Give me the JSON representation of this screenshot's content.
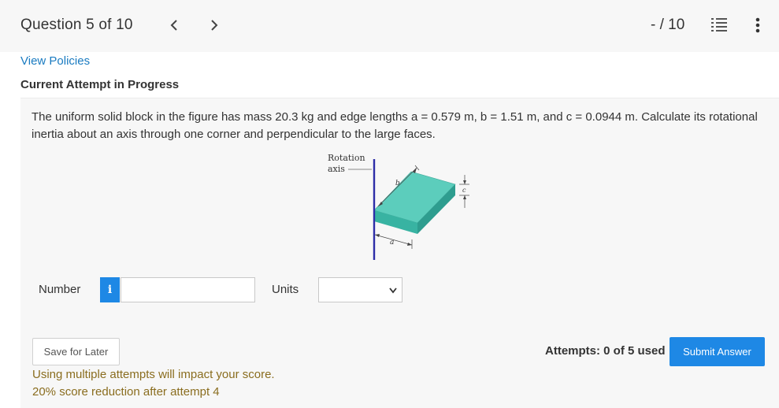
{
  "header": {
    "question_title": "Question 5 of 10",
    "score": "- / 10",
    "icons": [
      "chevron-left-icon",
      "chevron-right-icon",
      "list-icon",
      "more-vertical-icon"
    ]
  },
  "links": {
    "view_policies": "View Policies"
  },
  "attempt_heading": "Current Attempt in Progress",
  "problem": {
    "text": "The uniform solid block in the figure has mass 20.3 kg and edge lengths a = 0.579 m, b = 1.51 m, and c = 0.0944 m. Calculate its rotational inertia about an axis through one corner and perpendicular to the large faces.",
    "figure": {
      "axis_label_line1": "Rotation",
      "axis_label_line2": "axis",
      "label_a": "a",
      "label_b": "b",
      "label_c": "c",
      "block_color": "#5cc8b8",
      "axis_color": "#2d2da8"
    }
  },
  "answer": {
    "number_label": "Number",
    "info_label": "i",
    "number_value": "",
    "units_label": "Units",
    "units_selected": ""
  },
  "actions": {
    "save_label": "Save for Later",
    "attempts_text": "Attempts: 0 of 5 used",
    "submit_label": "Submit Answer"
  },
  "warnings": {
    "line1": "Using multiple attempts will impact your score.",
    "line2": "20% score reduction after attempt 4"
  },
  "colors": {
    "accent": "#1e88e5",
    "link": "#1a7bc1",
    "warning": "#8a6d1f"
  }
}
